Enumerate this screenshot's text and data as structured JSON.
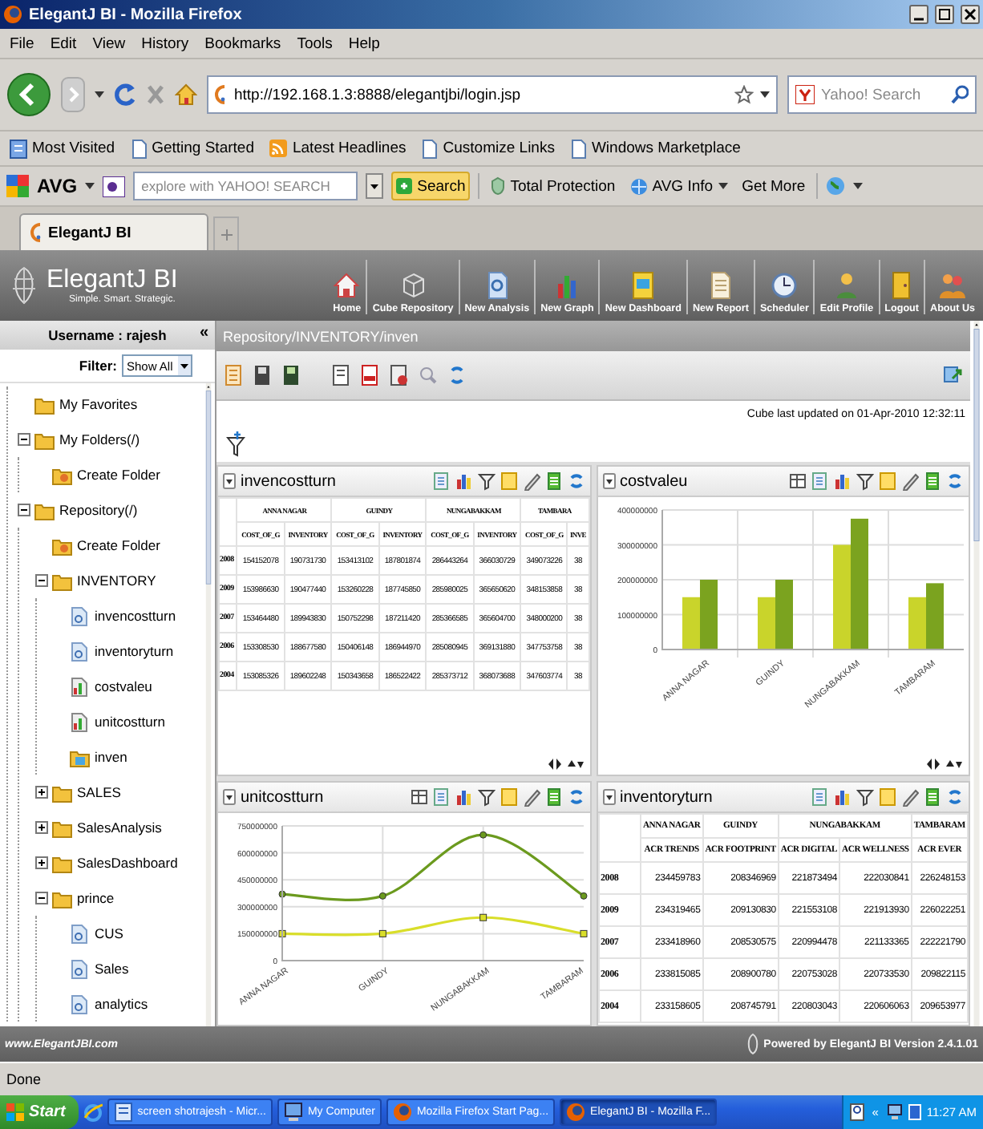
{
  "window": {
    "title": "ElegantJ BI - Mozilla Firefox"
  },
  "menu_bar": [
    "File",
    "Edit",
    "View",
    "History",
    "Bookmarks",
    "Tools",
    "Help"
  ],
  "address_bar": {
    "value": "http://192.168.1.3:8888/elegantjbi/login.jsp"
  },
  "search_field": {
    "placeholder": "Yahoo! Search"
  },
  "bookmarks": [
    {
      "label": "Most Visited",
      "kind": "folder"
    },
    {
      "label": "Getting Started",
      "kind": "page"
    },
    {
      "label": "Latest Headlines",
      "kind": "feed"
    },
    {
      "label": "Customize Links",
      "kind": "page"
    },
    {
      "label": "Windows Marketplace",
      "kind": "page"
    }
  ],
  "avg_toolbar": {
    "brand": "AVG",
    "search_placeholder": "explore with YAHOO! SEARCH",
    "buttons": [
      {
        "label": "Search",
        "kind": "search"
      },
      {
        "label": "Total Protection",
        "kind": "shield"
      },
      {
        "label": "AVG Info",
        "kind": "info"
      },
      {
        "label": "Get More",
        "kind": "plain"
      }
    ]
  },
  "tabs": [
    {
      "label": "ElegantJ BI",
      "selected": true
    }
  ],
  "app": {
    "logo": "ElegantJ BI",
    "tagline": "Simple. Smart. Strategic.",
    "nav": [
      {
        "label": "Home",
        "kind": "home"
      },
      {
        "label": "Cube Repository",
        "kind": "cube"
      },
      {
        "label": "New Analysis",
        "kind": "analysis"
      },
      {
        "label": "New Graph",
        "kind": "graph"
      },
      {
        "label": "New Dashboard",
        "kind": "dashboard"
      },
      {
        "label": "New Report",
        "kind": "report"
      },
      {
        "label": "Scheduler",
        "kind": "scheduler"
      },
      {
        "label": "Edit Profile",
        "kind": "profile"
      },
      {
        "label": "Logout",
        "kind": "logout"
      },
      {
        "label": "About Us",
        "kind": "about"
      }
    ]
  },
  "sidebar": {
    "username": "Username : rajesh",
    "collapse": "«",
    "filter_label": "Filter:",
    "filter_value": "Show All",
    "tree": [
      {
        "label": "My Favorites",
        "kind": "folder"
      },
      {
        "label": "My Folders(/)",
        "kind": "folder",
        "expanded": true,
        "children": [
          {
            "label": "Create Folder",
            "kind": "create"
          }
        ]
      },
      {
        "label": "Repository(/)",
        "kind": "folder",
        "expanded": true,
        "children": [
          {
            "label": "Create Folder",
            "kind": "create"
          },
          {
            "label": "INVENTORY",
            "kind": "folder",
            "expanded": true,
            "children": [
              {
                "label": "invencostturn",
                "kind": "analysis"
              },
              {
                "label": "inventoryturn",
                "kind": "analysis"
              },
              {
                "label": "costvaleu",
                "kind": "graph"
              },
              {
                "label": "unitcostturn",
                "kind": "graph"
              },
              {
                "label": "inven",
                "kind": "dashboard"
              }
            ]
          },
          {
            "label": "SALES",
            "kind": "folder",
            "expanded": false
          },
          {
            "label": "SalesAnalysis",
            "kind": "folder",
            "expanded": false
          },
          {
            "label": "SalesDashboard",
            "kind": "folder",
            "expanded": false
          },
          {
            "label": "prince",
            "kind": "folder",
            "expanded": true,
            "children": [
              {
                "label": "CUS",
                "kind": "analysis"
              },
              {
                "label": "Sales",
                "kind": "analysis"
              },
              {
                "label": "analytics",
                "kind": "analysis"
              }
            ]
          }
        ]
      }
    ]
  },
  "breadcrumb": "Repository/INVENTORY/inven",
  "cube_updated": "Cube last updated on 01-Apr-2010 12:32:11",
  "panels": [
    {
      "kind": "table",
      "title": "invencostturn",
      "groups": [
        {
          "label": "ANNA NAGAR",
          "columns": [
            "COST_OF_G",
            "INVENTORY"
          ]
        },
        {
          "label": "GUINDY",
          "columns": [
            "COST_OF_G",
            "INVENTORY"
          ]
        },
        {
          "label": "NUNGABAKKAM",
          "columns": [
            "COST_OF_G",
            "INVENTORY"
          ]
        },
        {
          "label": "TAMBARA",
          "columns": [
            "COST_OF_G",
            "INVE"
          ]
        }
      ],
      "rows": [
        {
          "label": "2008",
          "cells": [
            "154152078",
            "190731730",
            "153413102",
            "187801874",
            "286443264",
            "366030729",
            "349073226",
            "38"
          ]
        },
        {
          "label": "2009",
          "cells": [
            "153986630",
            "190477440",
            "153260228",
            "187745850",
            "285980025",
            "365650620",
            "348153858",
            "38"
          ]
        },
        {
          "label": "2007",
          "cells": [
            "153464480",
            "189943830",
            "150752298",
            "187211420",
            "285366585",
            "365604700",
            "348000200",
            "38"
          ]
        },
        {
          "label": "2006",
          "cells": [
            "153308530",
            "188677580",
            "150406148",
            "186944970",
            "285080945",
            "369131880",
            "347753758",
            "38"
          ]
        },
        {
          "label": "2004",
          "cells": [
            "153085326",
            "189602248",
            "150343658",
            "186522422",
            "285373712",
            "368073688",
            "347603774",
            "38"
          ]
        }
      ]
    },
    {
      "kind": "chart",
      "title": "costvaleu",
      "chart_data": {
        "type": "bar",
        "categories": [
          "ANNA NAGAR",
          "GUINDY",
          "NUNGABAKKAM",
          "TAMBARAM"
        ],
        "series": [
          {
            "color": "#c9d42b",
            "values": [
              150000000,
              150000000,
              300000000,
              150000000
            ]
          },
          {
            "color": "#7ba31f",
            "values": [
              200000000,
              200000000,
              375000000,
              190000000
            ]
          }
        ],
        "ylim": [
          0,
          400000000
        ],
        "yticks": [
          0,
          100000000,
          200000000,
          300000000,
          400000000
        ],
        "grid": true
      }
    },
    {
      "kind": "chart",
      "title": "unitcostturn",
      "chart_data": {
        "type": "line",
        "categories": [
          "ANNA NAGAR",
          "GUINDY",
          "NUNGABAKKAM",
          "TAMBARAM"
        ],
        "series": [
          {
            "color": "#6b9a1e",
            "marker": "circle",
            "values": [
              370000000,
              360000000,
              700000000,
              360000000
            ]
          },
          {
            "color": "#d9de2a",
            "marker": "square",
            "values": [
              150000000,
              150000000,
              240000000,
              150000000
            ]
          }
        ],
        "ylim": [
          0,
          750000000
        ],
        "yticks": [
          0,
          150000000,
          300000000,
          450000000,
          600000000,
          750000000
        ],
        "grid": true
      }
    },
    {
      "kind": "table",
      "title": "inventoryturn",
      "groups": [
        {
          "label": "ANNA NAGAR",
          "columns": [
            "ACR TRENDS"
          ]
        },
        {
          "label": "GUINDY",
          "columns": [
            "ACR FOOTPRINT"
          ]
        },
        {
          "label": "NUNGABAKKAM",
          "columns": [
            "ACR DIGITAL",
            "ACR WELLNESS"
          ]
        },
        {
          "label": "TAMBARAM",
          "columns": [
            "ACR EVER"
          ]
        }
      ],
      "rows": [
        {
          "label": "2008",
          "cells": [
            "234459783",
            "208346969",
            "221873494",
            "222030841",
            "226248153"
          ]
        },
        {
          "label": "2009",
          "cells": [
            "234319465",
            "209130830",
            "221553108",
            "221913930",
            "226022251"
          ]
        },
        {
          "label": "2007",
          "cells": [
            "233418960",
            "208530575",
            "220994478",
            "221133365",
            "222221790"
          ]
        },
        {
          "label": "2006",
          "cells": [
            "233815085",
            "208900780",
            "220753028",
            "220733530",
            "209822115"
          ]
        },
        {
          "label": "2004",
          "cells": [
            "233158605",
            "208745791",
            "220803043",
            "220606063",
            "209653977"
          ]
        }
      ]
    }
  ],
  "footer": {
    "link": "www.ElegantJBI.com",
    "powered": "Powered by ElegantJ BI Version 2.4.1.01"
  },
  "status_bar": "Done",
  "taskbar": {
    "start": "Start",
    "items": [
      {
        "label": "screen shotrajesh - Micr...",
        "kind": "document",
        "selected": false
      },
      {
        "label": "My Computer",
        "kind": "computer",
        "selected": false
      },
      {
        "label": "Mozilla Firefox Start Pag...",
        "kind": "browser",
        "selected": false
      },
      {
        "label": "ElegantJ BI - Mozilla F...",
        "kind": "browser",
        "selected": true
      }
    ],
    "tray_toggle": "«",
    "clock": "11:27 AM"
  }
}
